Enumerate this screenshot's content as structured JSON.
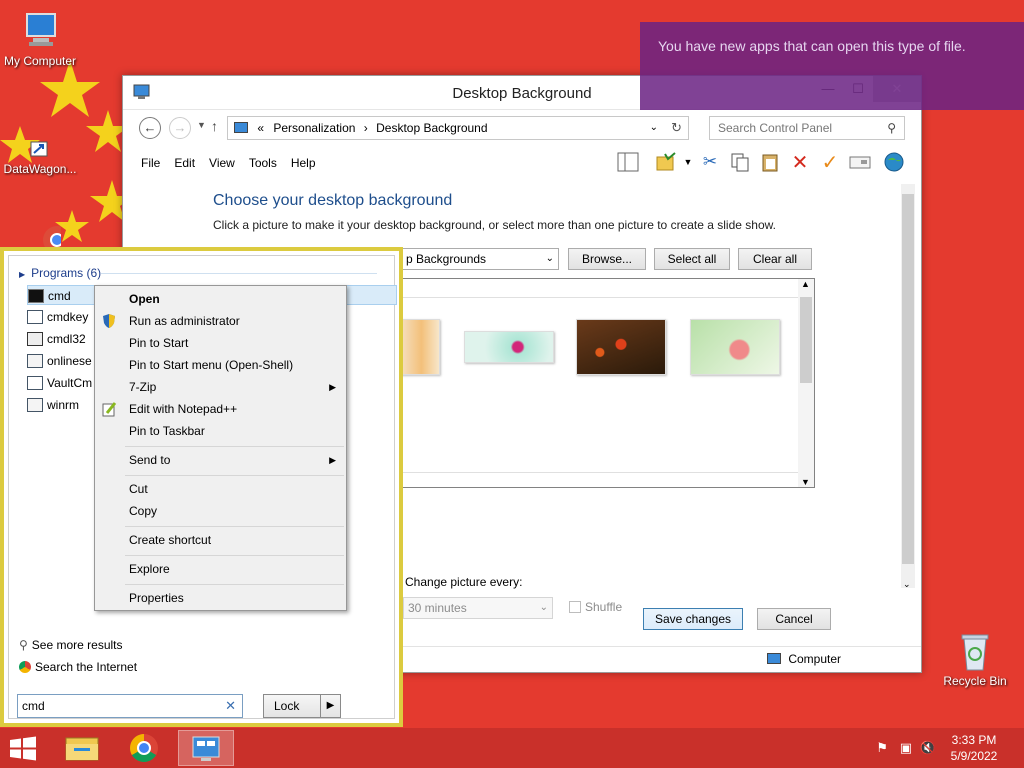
{
  "desktop": {
    "icons": [
      {
        "label": "My Computer"
      },
      {
        "label": "DataWagon..."
      },
      {
        "label": "Recycle Bin"
      }
    ]
  },
  "notification": {
    "text": "You have new apps that can open this type of file."
  },
  "window": {
    "title": "Desktop Background",
    "minimize": "—",
    "maximize": "☐",
    "close": "✕",
    "address": {
      "prefix": "«",
      "crumbs": [
        "Personalization",
        "Desktop Background"
      ],
      "separator": "›"
    },
    "search_placeholder": "Search Control Panel",
    "menu": [
      "File",
      "Edit",
      "View",
      "Tools",
      "Help"
    ],
    "heading": "Choose your desktop background",
    "subtext": "Click a picture to make it your desktop background, or select more than one picture to create a slide show.",
    "picture_location": "p Backgrounds",
    "browse_label": "Browse...",
    "select_all_label": "Select all",
    "clear_all_label": "Clear all",
    "change_picture_label": "Change picture every:",
    "interval_value": "30 minutes",
    "shuffle_label": "Shuffle",
    "save_label": "Save changes",
    "cancel_label": "Cancel",
    "status_text": "Computer"
  },
  "start_menu": {
    "programs_header": "Programs (6)",
    "programs": [
      {
        "label": "cmd"
      },
      {
        "label": "cmdkey"
      },
      {
        "label": "cmdl32"
      },
      {
        "label": "onlinese"
      },
      {
        "label": "VaultCm"
      },
      {
        "label": "winrm"
      }
    ],
    "see_more": "See more results",
    "search_internet": "Search the Internet",
    "search_value": "cmd",
    "search_clear": "✕",
    "lock_label": "Lock",
    "lock_arrow": "▶"
  },
  "context_menu": {
    "items": [
      {
        "label": "Open"
      },
      {
        "label": "Run as administrator"
      },
      {
        "label": "Pin to Start"
      },
      {
        "label": "Pin to Start menu (Open-Shell)"
      },
      {
        "label": "7-Zip"
      },
      {
        "label": "Edit with Notepad++"
      },
      {
        "label": "Pin to Taskbar"
      },
      {
        "label": "Send to"
      },
      {
        "label": "Cut"
      },
      {
        "label": "Copy"
      },
      {
        "label": "Create shortcut"
      },
      {
        "label": "Explore"
      },
      {
        "label": "Properties"
      }
    ],
    "submenu_arrow": "▶"
  },
  "taskbar": {
    "time": "3:33 PM",
    "date": "5/9/2022"
  },
  "colors": {
    "desktop": "#e43a2f",
    "accent": "#1e4e8c",
    "start_border": "#dccb3f",
    "notification": "#6b2383"
  }
}
